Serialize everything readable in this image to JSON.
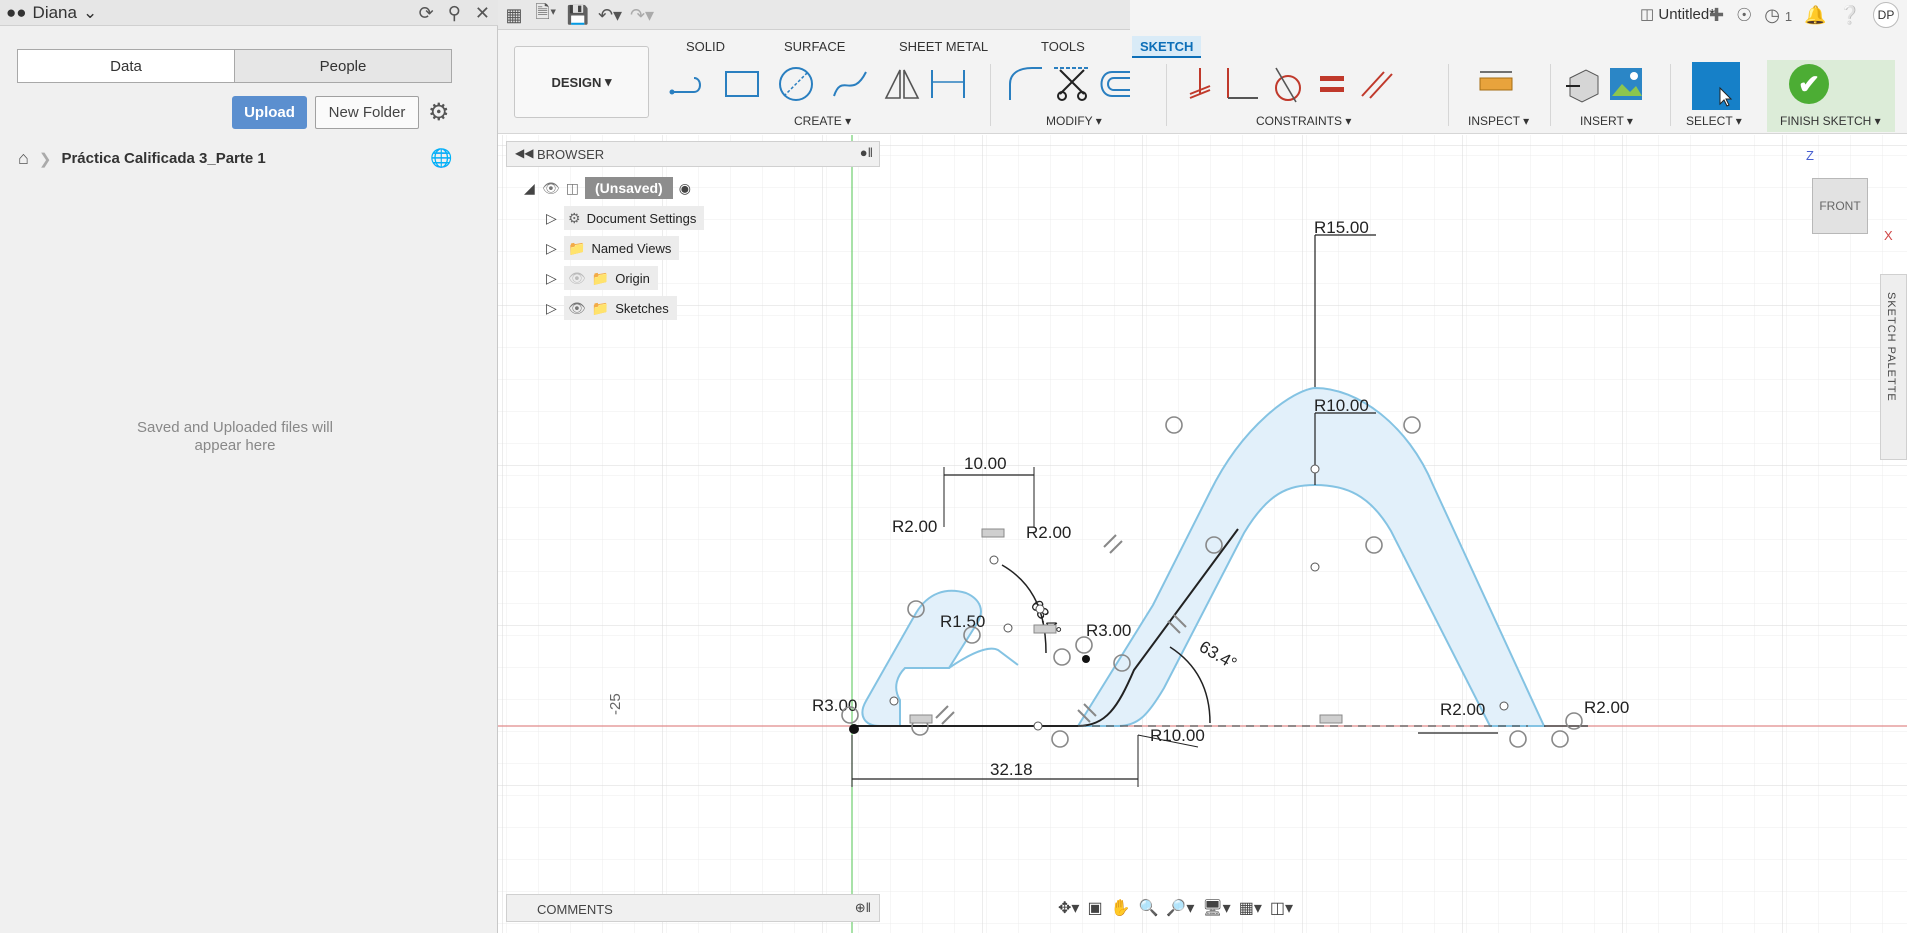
{
  "data_panel": {
    "user": "Diana",
    "tabs": [
      "Data",
      "People"
    ],
    "upload_label": "Upload",
    "new_folder_label": "New Folder",
    "breadcrumb": "Práctica Calificada 3_Parte 1",
    "empty_message": "Saved and Uploaded files will appear here"
  },
  "title_bar": {
    "doc_title": "Untitled*",
    "jobs_count": "1",
    "user_initials": "DP"
  },
  "ribbon": {
    "workspace": "DESIGN",
    "tabs": [
      "SOLID",
      "SURFACE",
      "SHEET METAL",
      "TOOLS",
      "SKETCH"
    ],
    "active_tab": "SKETCH",
    "groups": {
      "create": "CREATE",
      "modify": "MODIFY",
      "constraints": "CONSTRAINTS",
      "inspect": "INSPECT",
      "insert": "INSERT",
      "select": "SELECT",
      "finish": "FINISH SKETCH"
    }
  },
  "browser": {
    "title": "BROWSER",
    "root": "(Unsaved)",
    "items": [
      "Document Settings",
      "Named Views",
      "Origin",
      "Sketches"
    ]
  },
  "comments": {
    "title": "COMMENTS"
  },
  "viewcube": {
    "face": "FRONT",
    "axis_z": "Z",
    "axis_x": "X"
  },
  "sketch_palette": "SKETCH PALETTE",
  "dimensions": {
    "r15": "R15.00",
    "r10_top": "R10.00",
    "d10": "10.00",
    "r2_left": "R2.00",
    "r2_inner": "R2.00",
    "angle_inner": "63.4°",
    "r3": "R3.00",
    "r150": "R1.50",
    "angle_outer": "63.4°",
    "r3_left": "R3.00",
    "r10_bottom": "R10.00",
    "r2_right_a": "R2.00",
    "r2_right_b": "R2.00",
    "d32": "32.18",
    "axis_marker": "-25"
  },
  "colors": {
    "accent": "#0d6fb8",
    "profile_fill": "#e2f0fa",
    "profile_stroke": "#84c3e3",
    "select_blue": "#1680c8",
    "finish_green": "#4cad34"
  }
}
